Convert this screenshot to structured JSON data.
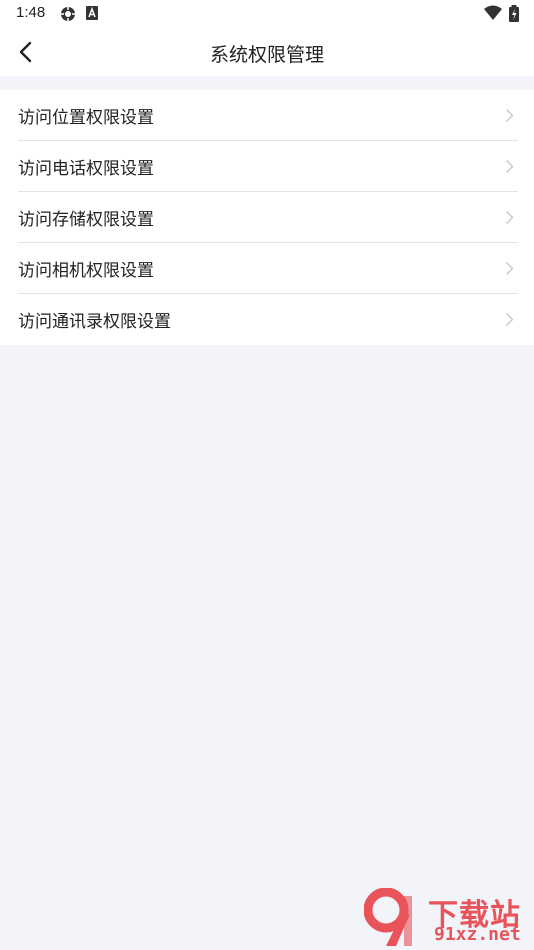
{
  "status_bar": {
    "time": "1:48"
  },
  "header": {
    "title": "系统权限管理"
  },
  "permissions": [
    {
      "label": "访问位置权限设置"
    },
    {
      "label": "访问电话权限设置"
    },
    {
      "label": "访问存储权限设置"
    },
    {
      "label": "访问相机权限设置"
    },
    {
      "label": "访问通讯录权限设置"
    }
  ],
  "watermark": {
    "line1": "下载站",
    "line2": "91xz.net",
    "logo": "9"
  },
  "colors": {
    "background": "#f2f4f9",
    "surface": "#ffffff",
    "text": "#222222",
    "chevron": "#c8c8c8",
    "watermark": "#e8545a"
  }
}
